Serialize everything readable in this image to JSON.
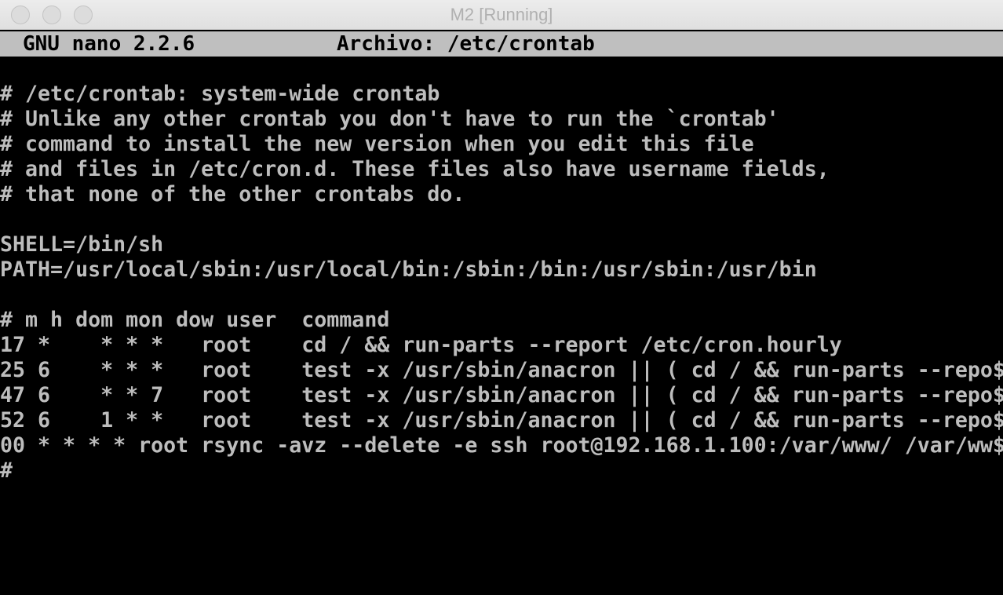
{
  "window": {
    "title": "M2 [Running]"
  },
  "nano": {
    "version": "GNU nano 2.2.6",
    "file_label": "Archivo: /etc/crontab"
  },
  "buffer": {
    "lines": [
      "# /etc/crontab: system-wide crontab",
      "# Unlike any other crontab you don't have to run the `crontab'",
      "# command to install the new version when you edit this file",
      "# and files in /etc/cron.d. These files also have username fields,",
      "# that none of the other crontabs do.",
      "",
      "SHELL=/bin/sh",
      "PATH=/usr/local/sbin:/usr/local/bin:/sbin:/bin:/usr/sbin:/usr/bin",
      "",
      "# m h dom mon dow user  command",
      "17 *    * * *   root    cd / && run-parts --report /etc/cron.hourly",
      "25 6    * * *   root    test -x /usr/sbin/anacron || ( cd / && run-parts --repo$",
      "47 6    * * 7   root    test -x /usr/sbin/anacron || ( cd / && run-parts --repo$",
      "52 6    1 * *   root    test -x /usr/sbin/anacron || ( cd / && run-parts --repo$",
      "00 * * * * root rsync -avz --delete -e ssh root@192.168.1.100:/var/www/ /var/ww$",
      "#"
    ]
  }
}
